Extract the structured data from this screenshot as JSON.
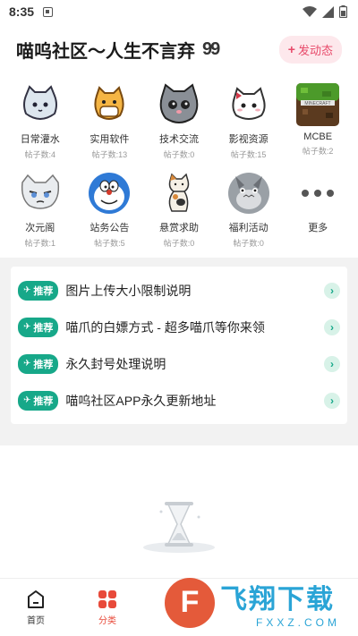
{
  "status_bar": {
    "time": "8:35"
  },
  "header": {
    "title": "喵呜社区～人生不言弃",
    "quote_glyph": "99",
    "post_button": "发动态",
    "post_plus": "+"
  },
  "categories": [
    {
      "name": "日常灌水",
      "count": "帖子数:4"
    },
    {
      "name": "实用软件",
      "count": "帖子数:13"
    },
    {
      "name": "技术交流",
      "count": "帖子数:0"
    },
    {
      "name": "影视资源",
      "count": "帖子数:15"
    },
    {
      "name": "MCBE",
      "count": "帖子数:2"
    },
    {
      "name": "次元阁",
      "count": "帖子数:1"
    },
    {
      "name": "站务公告",
      "count": "帖子数:5"
    },
    {
      "name": "悬赏求助",
      "count": "帖子数:0"
    },
    {
      "name": "福利活动",
      "count": "帖子数:0"
    },
    {
      "name": "更多",
      "count": ""
    }
  ],
  "notices": [
    {
      "tag": "推荐",
      "text": "图片上传大小限制说明"
    },
    {
      "tag": "推荐",
      "text": "喵爪的白嫖方式 - 超多喵爪等你来领"
    },
    {
      "tag": "推荐",
      "text": "永久封号处理说明"
    },
    {
      "tag": "推荐",
      "text": "喵呜社区APP永久更新地址"
    }
  ],
  "bottom_nav": [
    {
      "label": "首页"
    },
    {
      "label": "分类"
    }
  ],
  "watermark": {
    "title": "飞翔下载",
    "url": "FXXZ.COM"
  },
  "colors": {
    "accent_green": "#17a889",
    "accent_red": "#e84a3a",
    "post_pink": "#e84a6a"
  }
}
